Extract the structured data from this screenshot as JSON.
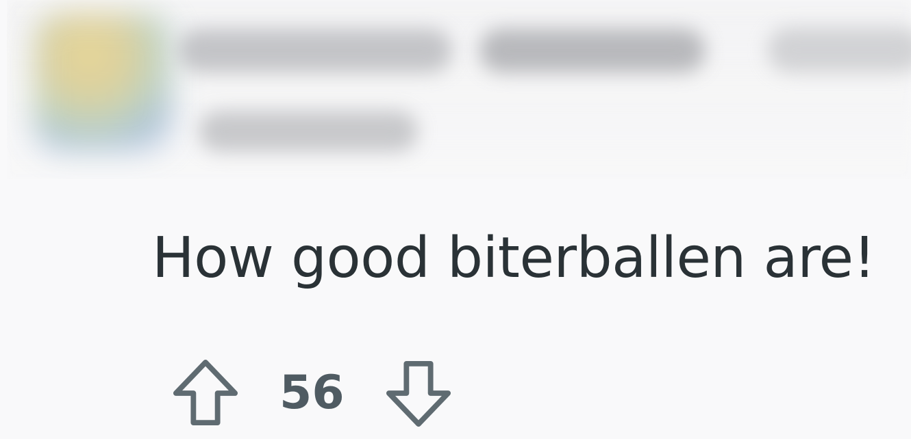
{
  "comment": {
    "body": "How good biterballen are!",
    "score": "56"
  },
  "icons": {
    "upvote": "arrow-up-outline-icon",
    "downvote": "arrow-down-outline-icon"
  },
  "colors": {
    "text": "#2a3236",
    "vote_icon": "#5f6b71",
    "score": "#4f5b62",
    "background": "#f9f9fa"
  }
}
